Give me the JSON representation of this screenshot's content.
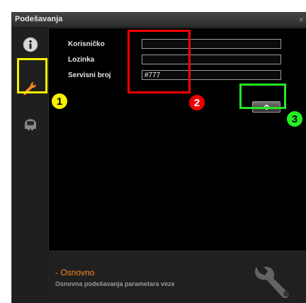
{
  "window": {
    "title": "Podešavanja",
    "close_symbol": "×"
  },
  "sidebar": {
    "items": [
      {
        "icon": "info-icon",
        "active": false
      },
      {
        "icon": "wrench-icon",
        "active": true,
        "color": "#ff8a1e"
      },
      {
        "icon": "astronaut-helmet-icon",
        "active": false
      }
    ]
  },
  "form": {
    "username_label": "Korisničko",
    "username_value": "",
    "password_label": "Lozinka",
    "password_value": "",
    "service_label": "Servisni broj",
    "service_value": "#777"
  },
  "go_button": {
    "icon": "circle-icon"
  },
  "footer": {
    "title": "- Osnovno",
    "description": "Osnovna podešavanja parametara veze",
    "accent_color": "#ff8a1e"
  },
  "annotations": {
    "badge1": "1",
    "badge2": "2",
    "badge3": "3",
    "colors": {
      "yellow": "#f2f000",
      "red": "#ff0000",
      "green": "#24e824"
    }
  }
}
